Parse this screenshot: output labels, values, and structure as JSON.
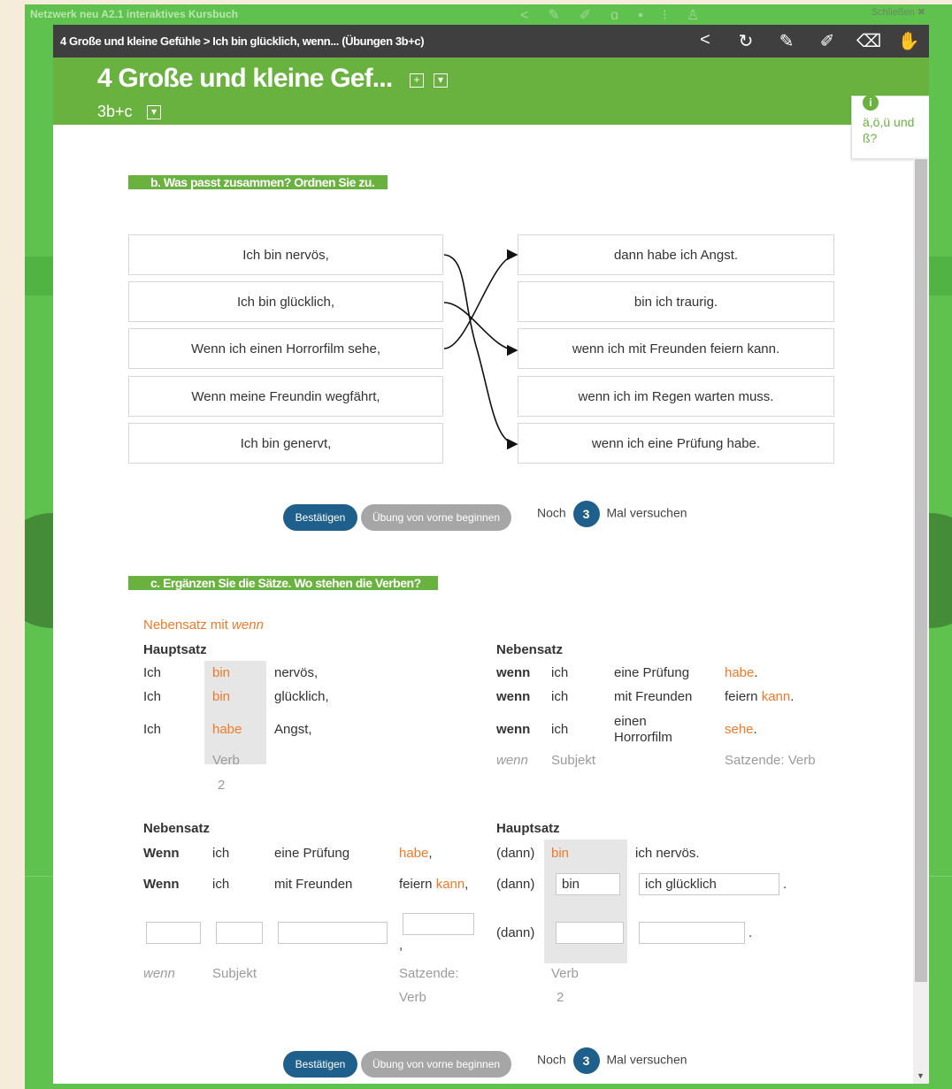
{
  "background": {
    "app_title": "Netzwerk neu A2.1 interaktives Kursbuch",
    "close_label": "Schließen"
  },
  "topbar": {
    "breadcrumb": "4 Große und kleine Gefühle > Ich bin glücklich, wenn... (Übungen 3b+c)"
  },
  "header": {
    "title": "4 Große und kleine Gef...",
    "subtitle": "3b+c"
  },
  "special_chars": {
    "label": "ä,ö,ü und ß?"
  },
  "exercise_b": {
    "heading": "b. Was passt zusammen? Ordnen Sie zu.",
    "left": [
      "Ich bin nervös,",
      "Ich bin glücklich,",
      "Wenn ich einen Horrorfilm sehe,",
      "Wenn meine Freundin wegfährt,",
      "Ich bin genervt,"
    ],
    "right": [
      "dann habe ich Angst.",
      "bin ich traurig.",
      "wenn ich mit Freunden feiern kann.",
      "wenn ich im Regen warten muss.",
      "wenn ich eine Prüfung habe."
    ],
    "confirm_label": "Bestätigen",
    "reset_label": "Übung von vorne beginnen",
    "tries_before": "Noch",
    "tries_count": "3",
    "tries_after": "Mal versuchen"
  },
  "exercise_c": {
    "heading": "c. Ergänzen Sie die Sätze. Wo stehen die Verben?",
    "nebensatz_title_a": "Nebensatz mit",
    "nebensatz_title_b": "wenn",
    "table1": {
      "hauptsatz_label": "Hauptsatz",
      "nebensatz_label": "Nebensatz",
      "rows": [
        {
          "subj": "Ich",
          "verb": "bin",
          "rest": "nervös,",
          "wenn": "wenn",
          "ich": "ich",
          "obj": "eine Prüfung",
          "end_a": "habe",
          "end_b": ".",
          "end_plain": ""
        },
        {
          "subj": "Ich",
          "verb": "bin",
          "rest": "glücklich,",
          "wenn": "wenn",
          "ich": "ich",
          "obj": "mit Freunden",
          "end_plain": "feiern ",
          "end_a": "kann",
          "end_b": "."
        },
        {
          "subj": "Ich",
          "verb": "habe",
          "rest": "Angst,",
          "wenn": "wenn",
          "ich": "ich",
          "obj": "einen Horrorfilm",
          "end_a": "sehe",
          "end_b": ".",
          "end_plain": ""
        }
      ],
      "verb_label": "Verb",
      "verb_pos": "2",
      "wenn_label": "wenn",
      "subjekt_label": "Subjekt",
      "satzende_label": "Satzende: Verb"
    },
    "table2": {
      "nebensatz_label": "Nebensatz",
      "hauptsatz_label": "Hauptsatz",
      "row1": {
        "wenn": "Wenn",
        "ich": "ich",
        "obj": "eine Prüfung",
        "end": "habe",
        "comma": ",",
        "dann": "(dann)",
        "verb": "bin",
        "rest": "ich nervös."
      },
      "row2": {
        "wenn": "Wenn",
        "ich": "ich",
        "obj": "mit Freunden",
        "end_plain": "feiern ",
        "end": "kann",
        "comma": ",",
        "dann": "(dann)",
        "verb_value": "bin",
        "rest_value": "ich glücklich",
        "period": "."
      },
      "row3": {
        "comma": ",",
        "dann": "(dann)",
        "period": "."
      },
      "wenn_label": "wenn",
      "subjekt_label": "Subjekt",
      "satzende_label_1": "Satzende:",
      "satzende_label_2": "Verb",
      "verb_label": "Verb",
      "verb_pos": "2"
    },
    "confirm_label": "Bestätigen",
    "reset_label": "Übung von vorne beginnen",
    "tries_before": "Noch",
    "tries_count": "3",
    "tries_after": "Mal versuchen"
  },
  "colors": {
    "green": "#6ab23f",
    "orange": "#f07a2a",
    "blue": "#1f5f8b",
    "dark": "#3f3f3f"
  }
}
